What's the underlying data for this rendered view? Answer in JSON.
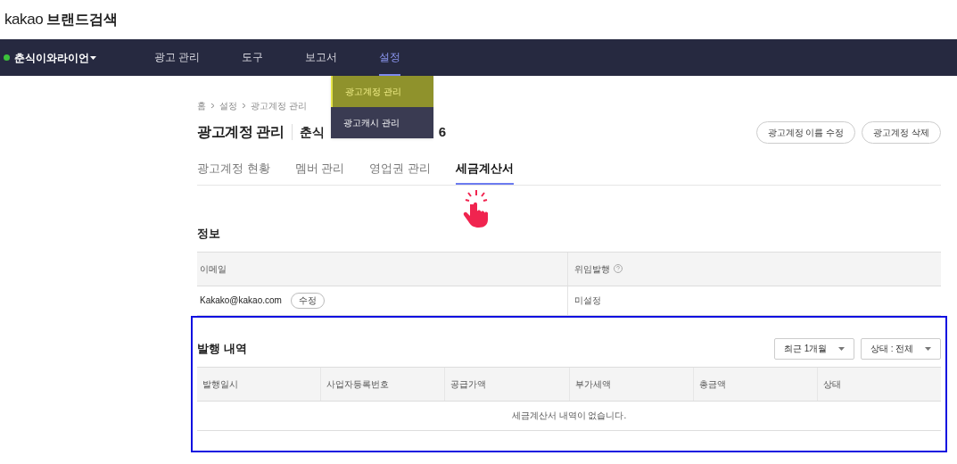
{
  "logo": {
    "brand": "kakao",
    "service": "브랜드검색"
  },
  "account_switcher": {
    "name": "춘식이와라이언",
    "color": "#3cc13b"
  },
  "nav": [
    {
      "label": "광고 관리",
      "selected": false
    },
    {
      "label": "도구",
      "selected": false
    },
    {
      "label": "보고서",
      "selected": false
    },
    {
      "label": "설정",
      "selected": true
    }
  ],
  "dropdown_menu": [
    {
      "label": "광고계정 관리",
      "selected": true
    },
    {
      "label": "광고캐시 관리",
      "selected": false
    }
  ],
  "breadcrumb": [
    "홈",
    "설정",
    "광고계정 관리"
  ],
  "page_title": "광고계정 관리",
  "account_title_start": "춘식",
  "account_title_end": "6",
  "header_buttons": [
    "광고계정 이름 수정",
    "광고계정 삭제"
  ],
  "tabs": [
    {
      "label": "광고계정 현황",
      "selected": false
    },
    {
      "label": "멤버 관리",
      "selected": false
    },
    {
      "label": "영업권 관리",
      "selected": false
    },
    {
      "label": "세금계산서",
      "selected": true
    }
  ],
  "info": {
    "title": "정보",
    "columns": [
      "이메일",
      "위임발행"
    ],
    "email": "Kakako@kakao.com",
    "edit_button": "수정",
    "delegation": "미설정"
  },
  "history": {
    "title": "발행 내역",
    "filters": [
      "최근 1개월",
      "상태 : 전체"
    ],
    "columns": [
      "발행일시",
      "사업자등록번호",
      "공급가액",
      "부가세액",
      "총금액",
      "상태"
    ],
    "empty_message": "세금계산서 내역이 없습니다."
  }
}
